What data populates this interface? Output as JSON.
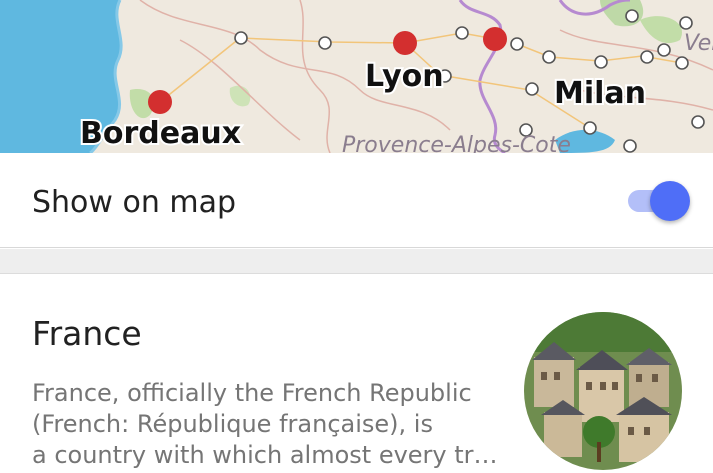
{
  "map": {
    "cities": [
      {
        "name": "Bordeaux"
      },
      {
        "name": "Lyon"
      },
      {
        "name": "Milan"
      }
    ],
    "region_label": "Provence-Alpes-Cote",
    "partial_label": "Ver"
  },
  "settings": {
    "show_on_map_label": "Show on map",
    "show_on_map_enabled": true
  },
  "article": {
    "title": "France",
    "description_lines": [
      "France, officially the French Republic",
      "(French: République française), is",
      "a country with which almost every tr…"
    ],
    "thumbnail_icon": "village-photo"
  },
  "colors": {
    "accent": "#4f6ef7",
    "marker": "#d32f2f",
    "sea": "#5fb8e0"
  }
}
